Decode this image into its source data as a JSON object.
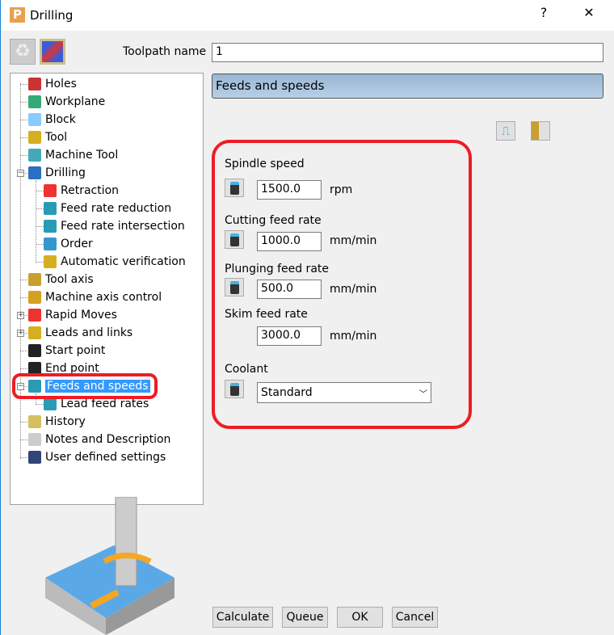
{
  "window": {
    "title": "Drilling",
    "help": "?",
    "close": "✕"
  },
  "toolpath": {
    "label": "Toolpath name",
    "value": "1"
  },
  "tree": [
    {
      "label": "Holes",
      "level": 0
    },
    {
      "label": "Workplane",
      "level": 0
    },
    {
      "label": "Block",
      "level": 0
    },
    {
      "label": "Tool",
      "level": 0
    },
    {
      "label": "Machine Tool",
      "level": 0
    },
    {
      "label": "Drilling",
      "level": 0,
      "expander": "−"
    },
    {
      "label": "Retraction",
      "level": 1
    },
    {
      "label": "Feed rate reduction",
      "level": 1
    },
    {
      "label": "Feed rate intersection",
      "level": 1
    },
    {
      "label": "Order",
      "level": 1
    },
    {
      "label": "Automatic verification",
      "level": 1
    },
    {
      "label": "Tool axis",
      "level": 0
    },
    {
      "label": "Machine axis control",
      "level": 0
    },
    {
      "label": "Rapid Moves",
      "level": 0,
      "expander": "+"
    },
    {
      "label": "Leads and links",
      "level": 0,
      "expander": "+"
    },
    {
      "label": "Start point",
      "level": 0
    },
    {
      "label": "End point",
      "level": 0
    },
    {
      "label": "Feeds and speeds",
      "level": 0,
      "expander": "−",
      "selected": true
    },
    {
      "label": "Lead feed rates",
      "level": 1
    },
    {
      "label": "History",
      "level": 0
    },
    {
      "label": "Notes and Description",
      "level": 0
    },
    {
      "label": "User defined settings",
      "level": 0
    }
  ],
  "panel": {
    "header": "Feeds and speeds",
    "spindle": {
      "label": "Spindle speed",
      "value": "1500.0",
      "unit": "rpm"
    },
    "cutting": {
      "label": "Cutting feed rate",
      "value": "1000.0",
      "unit": "mm/min"
    },
    "plunging": {
      "label": "Plunging feed rate",
      "value": "500.0",
      "unit": "mm/min"
    },
    "skim": {
      "label": "Skim feed rate",
      "value": "3000.0",
      "unit": "mm/min"
    },
    "coolant": {
      "label": "Coolant",
      "value": "Standard"
    }
  },
  "buttons": {
    "calculate": "Calculate",
    "queue": "Queue",
    "ok": "OK",
    "cancel": "Cancel"
  },
  "colors": {
    "highlight": "#3399ff",
    "annotation": "#ee1c25",
    "header": "#a7c2dd"
  }
}
